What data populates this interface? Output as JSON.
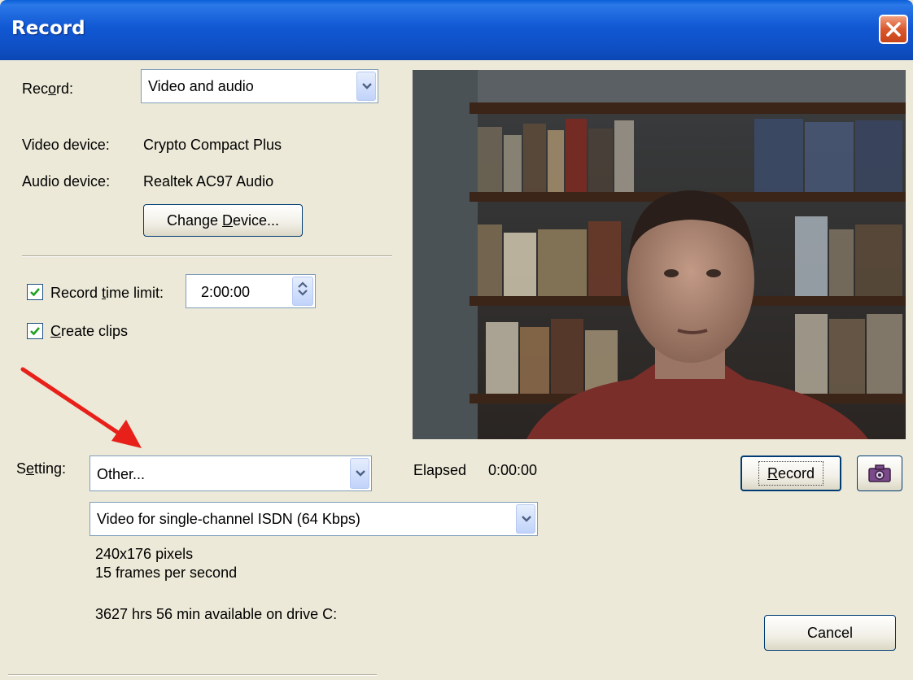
{
  "window": {
    "title": "Record"
  },
  "record": {
    "label_pre": "Rec",
    "label_u": "o",
    "label_post": "rd:",
    "value": "Video and audio"
  },
  "devices": {
    "video_label": "Video device:",
    "video_value": "Crypto Compact Plus",
    "audio_label": "Audio device:",
    "audio_value": "Realtek AC97 Audio",
    "change_pre": "Change ",
    "change_u": "D",
    "change_post": "evice..."
  },
  "time_limit": {
    "checked": true,
    "label_pre": "Record ",
    "label_u": "t",
    "label_post": "ime limit:",
    "value": "2:00:00"
  },
  "clips": {
    "checked": true,
    "label_u": "C",
    "label_post": "reate clips"
  },
  "setting": {
    "label_pre": "S",
    "label_u": "e",
    "label_post": "tting:",
    "value": "Other...",
    "profile": "Video for single-channel ISDN (64 Kbps)",
    "resolution": "240x176 pixels",
    "fps": "15 frames per second",
    "available": "3627 hrs  56 min available on drive C:"
  },
  "elapsed": {
    "label": "Elapsed",
    "value": "0:00:00"
  },
  "buttons": {
    "record_u": "R",
    "record_post": "ecord",
    "cancel": "Cancel"
  },
  "icons": {
    "close": "close-icon",
    "dropdown": "chevron-down-icon",
    "spin": "spin-updown-icon",
    "snapshot": "camera-icon",
    "annotation": "red-arrow"
  },
  "colors": {
    "titlebar": "#0f4fc4",
    "dialog": "#ece9d8",
    "close": "#d9582e",
    "arrow": "#e8201a"
  }
}
